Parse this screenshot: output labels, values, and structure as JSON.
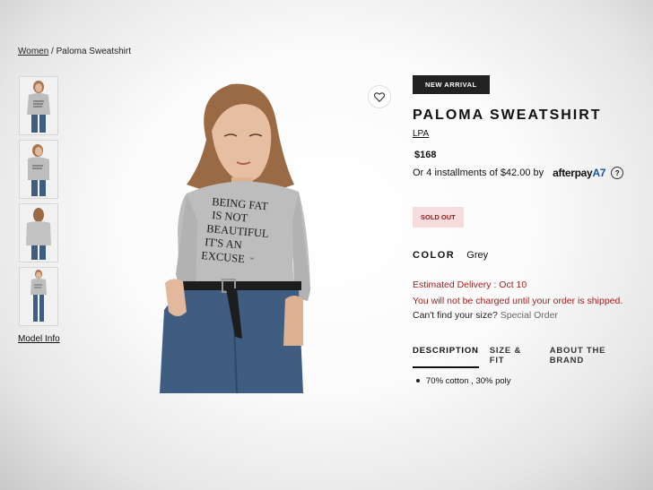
{
  "breadcrumb": {
    "parent": "Women",
    "separator": " / ",
    "current": "Paloma Sweatshirt"
  },
  "thumbnails": [
    {
      "view": "front"
    },
    {
      "view": "side"
    },
    {
      "view": "back"
    },
    {
      "view": "full"
    }
  ],
  "model_info": "Model Info",
  "product": {
    "badge": "NEW ARRIVAL",
    "title": "PALOMA SWEATSHIRT",
    "brand": "LPA",
    "price": "$168",
    "installments_text": "Or 4 installments of $42.00 by",
    "afterpay_text": "afterpay",
    "afterpay_mark": "A7",
    "help_glyph": "?",
    "stock_status": "SOLD OUT",
    "color_label": "COLOR",
    "color_value": "Grey",
    "delivery": "Estimated Delivery : Oct 10",
    "charge_notice": "You will not be charged until your order is shipped.",
    "size_question": "Can't find your size?",
    "special_order": "Special Order",
    "shirt_print": [
      "BEING FAT",
      "IS NOT",
      "BEAUTIFUL",
      "IT'S AN",
      "EXCUSE"
    ],
    "shirt_brand_mark": "™"
  },
  "tabs": [
    {
      "label": "DESCRIPTION",
      "active": true
    },
    {
      "label": "SIZE & FIT",
      "active": false
    },
    {
      "label": "ABOUT THE BRAND",
      "active": false
    }
  ],
  "details": [
    "70% cotton , 30% poly"
  ],
  "colors": {
    "accent_red": "#a31d1d",
    "soldout_bg": "#f6dcdc",
    "badge_bg": "#222222",
    "sweater": "#bdbdbd",
    "denim": "#3f5d80"
  }
}
